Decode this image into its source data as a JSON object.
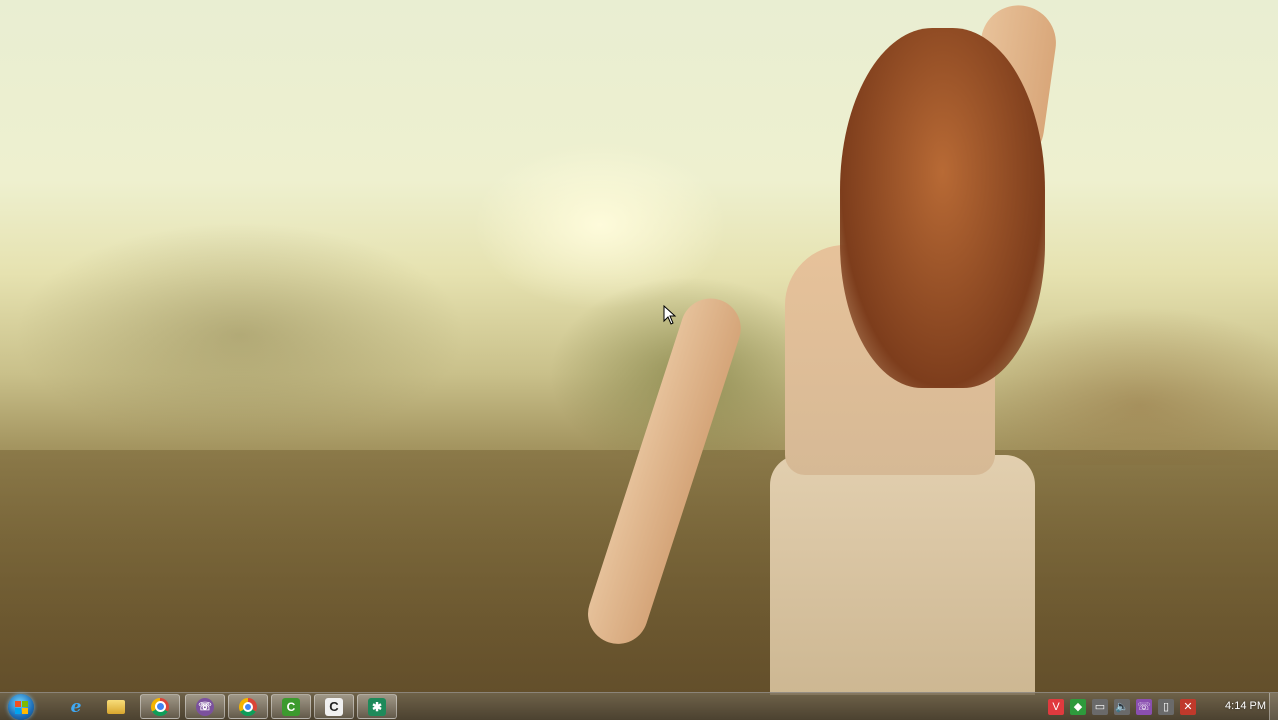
{
  "desktop": {
    "wallpaper": "woman-in-sunlit-field"
  },
  "taskbar": {
    "start_button": "windows-start-orb",
    "pinned": [
      {
        "name": "internet-explorer-icon",
        "glyph": "e",
        "open": false
      },
      {
        "name": "file-explorer-icon",
        "glyph": "",
        "open": false
      },
      {
        "name": "chrome-icon",
        "glyph": "",
        "open": true
      },
      {
        "name": "viber-icon",
        "glyph": "☏",
        "open": true
      },
      {
        "name": "chrome-app-icon",
        "glyph": "",
        "open": true
      },
      {
        "name": "camtasia-icon",
        "glyph": "C",
        "open": true
      },
      {
        "name": "capture-icon",
        "glyph": "C",
        "open": true
      },
      {
        "name": "app-icon",
        "glyph": "✱",
        "open": true
      }
    ],
    "tray": [
      {
        "name": "vivaldi-tray-icon",
        "glyph": "V",
        "color": "#e03a3e"
      },
      {
        "name": "network-share-tray-icon",
        "glyph": "◆",
        "color": "#2e9a3c"
      },
      {
        "name": "action-center-tray-icon",
        "glyph": "▭",
        "color": "#6a6a6a"
      },
      {
        "name": "volume-tray-icon",
        "glyph": "🔈",
        "color": "#6a6a6a"
      },
      {
        "name": "viber-tray-icon",
        "glyph": "☏",
        "color": "#8a4fb0"
      },
      {
        "name": "clipboard-tray-icon",
        "glyph": "▯",
        "color": "#6a6a6a"
      },
      {
        "name": "network-disconnected-tray-icon",
        "glyph": "✕",
        "color": "#c0392b"
      }
    ],
    "clock": "4:14 PM"
  }
}
